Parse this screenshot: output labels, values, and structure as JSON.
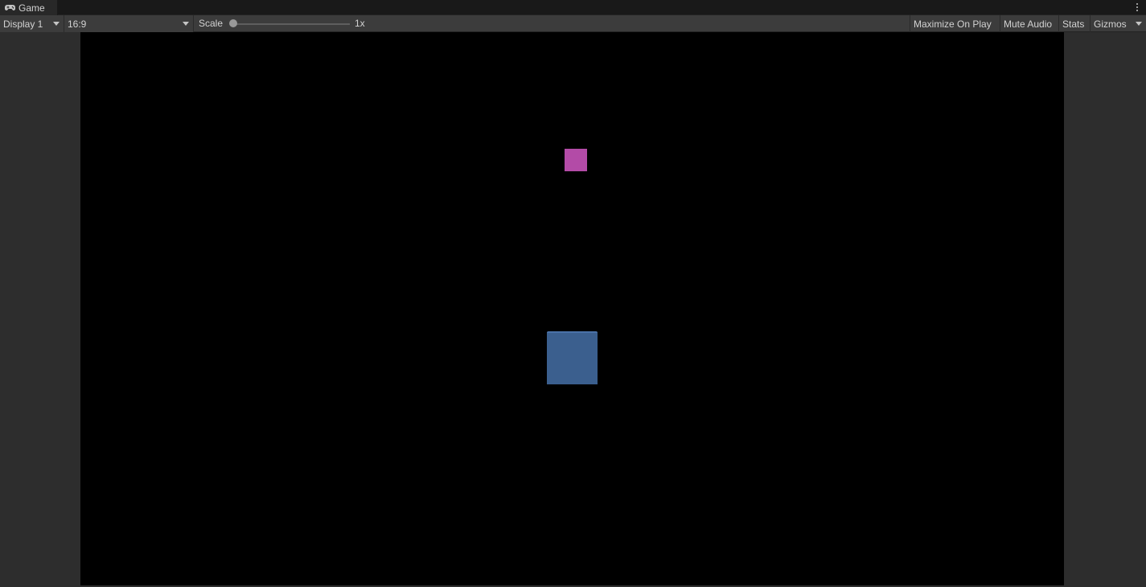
{
  "tab": {
    "label": "Game",
    "icon": "gamepad-icon"
  },
  "toolbar": {
    "display": "Display 1",
    "aspect": "16:9",
    "scale_label": "Scale",
    "scale_value": "1x",
    "scale_slider_fraction": 0,
    "maximize_on_play": "Maximize On Play",
    "mute_audio": "Mute Audio",
    "stats": "Stats",
    "gizmos": "Gizmos"
  },
  "scene": {
    "background": "#000000",
    "objects": [
      {
        "name": "pink-cube",
        "color": "#b34ba7"
      },
      {
        "name": "blue-cube",
        "color": "#3b5f8e"
      }
    ]
  },
  "colors": {
    "editor_bg": "#1e1e1e",
    "toolbar_bg": "#3c3c3c",
    "text": "#d2d2d2"
  }
}
